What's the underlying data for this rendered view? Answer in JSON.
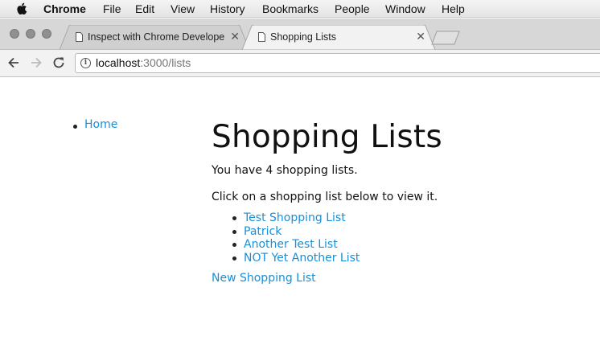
{
  "menubar": {
    "app_name": "Chrome",
    "items": [
      "File",
      "Edit",
      "View",
      "History",
      "Bookmarks",
      "People",
      "Window",
      "Help"
    ]
  },
  "tabs": [
    {
      "title": "Inspect with Chrome Develope",
      "active": false
    },
    {
      "title": "Shopping Lists",
      "active": true
    }
  ],
  "address_bar": {
    "host": "localhost",
    "path": ":3000/lists"
  },
  "page": {
    "nav": {
      "home_label": "Home"
    },
    "heading": "Shopping Lists",
    "count_text": "You have 4 shopping lists.",
    "instructions": "Click on a shopping list below to view it.",
    "lists": [
      "Test Shopping List",
      "Patrick",
      "Another Test List",
      "NOT Yet Another List"
    ],
    "new_list_label": "New Shopping List"
  },
  "colors": {
    "link": "#1a8fd8",
    "traffic_light": "#8f8f8f"
  }
}
